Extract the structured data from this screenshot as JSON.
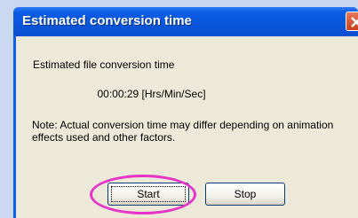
{
  "window": {
    "title": "Estimated conversion time",
    "close_icon": "close-icon"
  },
  "content": {
    "heading": "Estimated file conversion time",
    "time_value": "00:00:29 [Hrs/Min/Sec]",
    "note": "Note: Actual conversion time may differ depending on animation effects used and other factors."
  },
  "buttons": {
    "start_label": "Start",
    "stop_label": "Stop"
  },
  "colors": {
    "titlebar": "#0b5ce6",
    "client_bg": "#ece9d8",
    "highlight": "#e633c8"
  }
}
